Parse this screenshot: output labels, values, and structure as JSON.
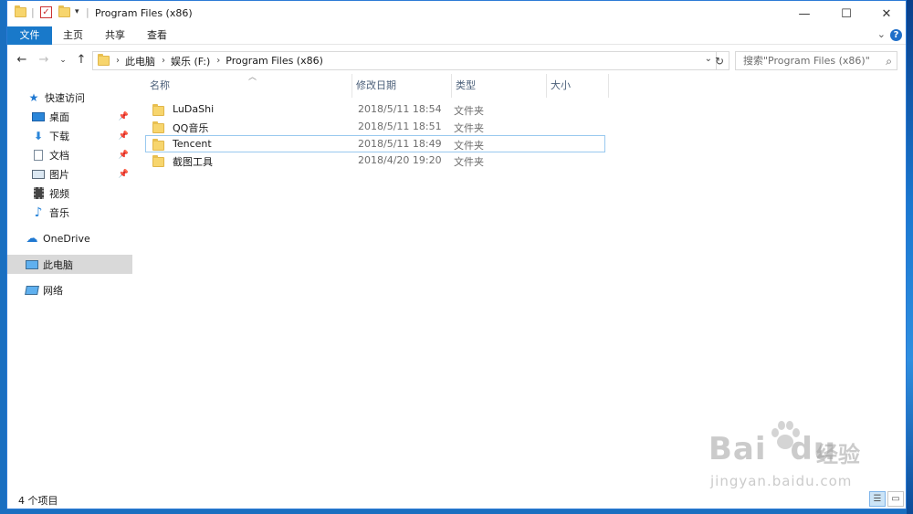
{
  "window": {
    "title": "Program Files (x86)",
    "controls": {
      "minimize": "—",
      "maximize": "☐",
      "close": "✕"
    }
  },
  "ribbon": {
    "tabs": [
      {
        "label": "文件",
        "active": true
      },
      {
        "label": "主页"
      },
      {
        "label": "共享"
      },
      {
        "label": "查看"
      }
    ],
    "help": "?"
  },
  "address": {
    "crumbs": [
      "此电脑",
      "娱乐 (F:)",
      "Program Files (x86)"
    ],
    "search_placeholder": "搜索\"Program Files (x86)\""
  },
  "navpane": {
    "quick_access": "快速访问",
    "items": [
      {
        "label": "桌面",
        "icon": "desktop-icon",
        "pinned": true
      },
      {
        "label": "下载",
        "icon": "download-icon",
        "pinned": true
      },
      {
        "label": "文档",
        "icon": "document-icon",
        "pinned": true
      },
      {
        "label": "图片",
        "icon": "picture-icon",
        "pinned": true
      },
      {
        "label": "视频",
        "icon": "video-icon",
        "pinned": false
      },
      {
        "label": "音乐",
        "icon": "music-icon",
        "pinned": false
      }
    ],
    "onedrive": "OneDrive",
    "this_pc": "此电脑",
    "network": "网络"
  },
  "filelist": {
    "columns": [
      "名称",
      "修改日期",
      "类型",
      "大小"
    ],
    "rows": [
      {
        "name": "LuDaShi",
        "date": "2018/5/11 18:54",
        "type": "文件夹"
      },
      {
        "name": "QQ音乐",
        "date": "2018/5/11 18:51",
        "type": "文件夹"
      },
      {
        "name": "Tencent",
        "date": "2018/5/11 18:49",
        "type": "文件夹",
        "focused": true
      },
      {
        "name": "截图工具",
        "date": "2018/4/20 19:20",
        "type": "文件夹"
      }
    ]
  },
  "status": {
    "item_count": "4 个项目"
  },
  "watermark": {
    "brand": "Bai",
    "brand2": "du",
    "cn": "经验",
    "url": "jingyan.baidu.com"
  },
  "colors": {
    "accent": "#1979ca",
    "folder": "#f7d56d",
    "selection": "#99c9ef"
  }
}
